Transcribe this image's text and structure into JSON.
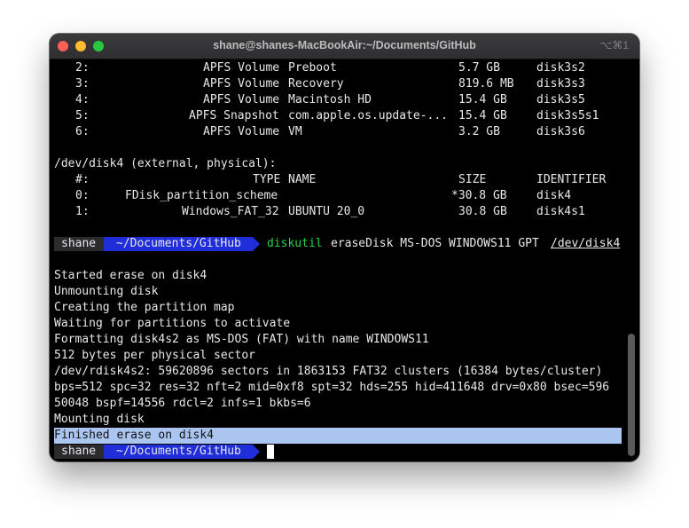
{
  "window": {
    "title": "shane@shanes-MacBookAir:~/Documents/GitHub",
    "shortcut": "⌥⌘1"
  },
  "disk3_rows": [
    {
      "num": "2:",
      "type": "APFS Volume",
      "name": "Preboot",
      "size": "5.7 GB",
      "id": "disk3s2"
    },
    {
      "num": "3:",
      "type": "APFS Volume",
      "name": "Recovery",
      "size": "819.6 MB",
      "id": "disk3s3"
    },
    {
      "num": "4:",
      "type": "APFS Volume",
      "name": "Macintosh HD",
      "size": "15.4 GB",
      "id": "disk3s5"
    },
    {
      "num": "5:",
      "type": "APFS Snapshot",
      "name": "com.apple.os.update-...",
      "size": "15.4 GB",
      "id": "disk3s5s1"
    },
    {
      "num": "6:",
      "type": "APFS Volume",
      "name": "VM",
      "size": "3.2 GB",
      "id": "disk3s6"
    }
  ],
  "disk4": {
    "header": "/dev/disk4 (external, physical):",
    "columns": {
      "num": "#:",
      "type": "TYPE",
      "name": "NAME",
      "size": "SIZE",
      "id": "IDENTIFIER"
    },
    "rows": [
      {
        "num": "0:",
        "type": "FDisk_partition_scheme",
        "name": "",
        "size": "*30.8 GB",
        "id": "disk4"
      },
      {
        "num": "1:",
        "type": "Windows_FAT_32",
        "name": "UBUNTU 20_0",
        "size": "30.8 GB",
        "id": "disk4s1"
      }
    ]
  },
  "prompt": {
    "user": "shane",
    "path": "~/Documents/GitHub"
  },
  "command": {
    "program": "diskutil",
    "args": "eraseDisk MS-DOS WINDOWS11 GPT",
    "target": "/dev/disk4"
  },
  "output": [
    "Started erase on disk4",
    "Unmounting disk",
    "Creating the partition map",
    "Waiting for partitions to activate",
    "Formatting disk4s2 as MS-DOS (FAT) with name WINDOWS11",
    "512 bytes per physical sector",
    "/dev/rdisk4s2: 59620896 sectors in 1863153 FAT32 clusters (16384 bytes/cluster)",
    "bps=512 spc=32 res=32 nft=2 mid=0xf8 spt=32 hds=255 hid=411648 drv=0x80 bsec=596",
    "50048 bspf=14556 rdcl=2 infs=1 bkbs=6",
    "Mounting disk",
    "Finished erase on disk4"
  ],
  "colors": {
    "background": "#000000",
    "selection": "#aac5f0",
    "prompt_path_bg": "#1f2ed8",
    "command_green": "#26d24e"
  }
}
